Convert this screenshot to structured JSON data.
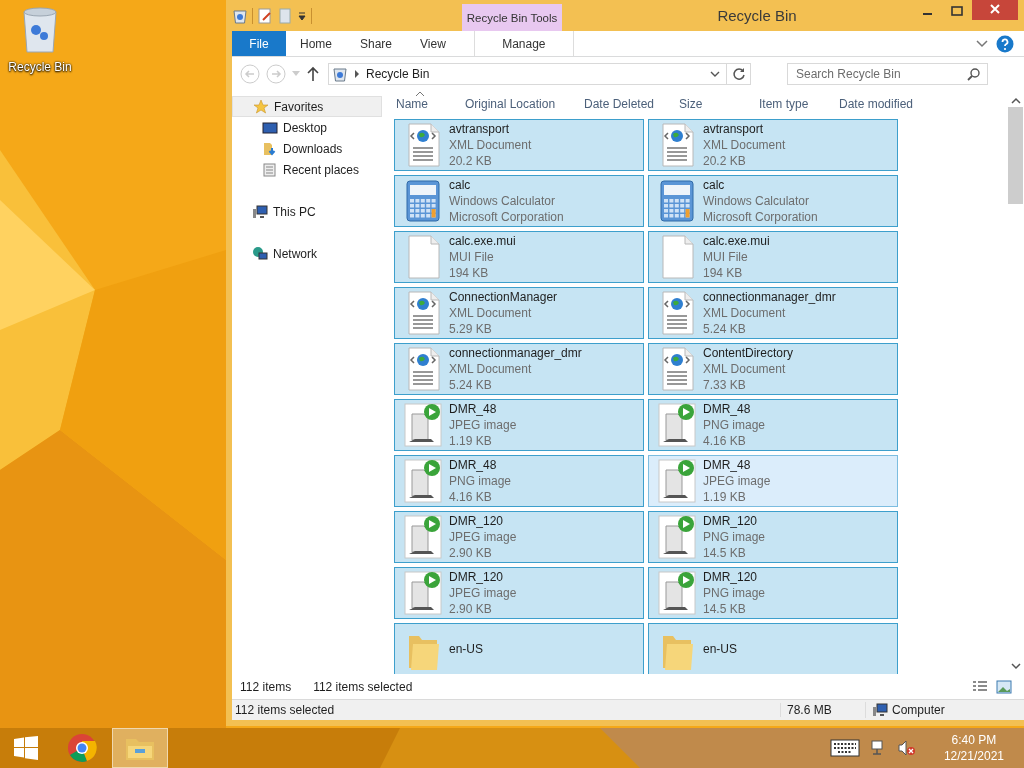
{
  "desktop": {
    "icons": [
      {
        "label": "Recycle Bin"
      }
    ]
  },
  "window": {
    "title": "Recycle Bin",
    "context_group": "Recycle Bin Tools"
  },
  "ribbon_tabs": [
    {
      "label": "File",
      "kind": "file",
      "selected": false
    },
    {
      "label": "Home",
      "kind": "plain",
      "selected": false
    },
    {
      "label": "Share",
      "kind": "plain",
      "selected": false
    },
    {
      "label": "View",
      "kind": "plain",
      "selected": false
    },
    {
      "label": "Manage",
      "kind": "context",
      "selected": false
    }
  ],
  "address_bar": {
    "path": "Recycle Bin"
  },
  "search": {
    "placeholder": "Search Recycle Bin"
  },
  "nav_pane": {
    "groups": [
      {
        "label": "Favorites",
        "kind": "star",
        "hovered": true,
        "children": [
          {
            "label": "Desktop",
            "kind": "desktop",
            "hovered": false
          },
          {
            "label": "Downloads",
            "kind": "downloads",
            "hovered": false
          },
          {
            "label": "Recent places",
            "kind": "recent",
            "hovered": false
          }
        ]
      },
      {
        "label": "This PC",
        "kind": "pc",
        "hovered": false
      },
      {
        "label": "Network",
        "kind": "network",
        "hovered": false
      }
    ]
  },
  "columns": [
    "Name",
    "Original Location",
    "Date Deleted",
    "Size",
    "Item type",
    "Date modified"
  ],
  "items": [
    {
      "name": "avtransport",
      "lines": [
        "XML Document",
        "20.2 KB"
      ],
      "kind": "xml",
      "selected": true,
      "hovered": false
    },
    {
      "name": "avtransport",
      "lines": [
        "XML Document",
        "20.2 KB"
      ],
      "kind": "xml",
      "selected": true,
      "hovered": false
    },
    {
      "name": "calc",
      "lines": [
        "Windows Calculator",
        "Microsoft Corporation"
      ],
      "kind": "calc",
      "selected": true,
      "hovered": false
    },
    {
      "name": "calc",
      "lines": [
        "Windows Calculator",
        "Microsoft Corporation"
      ],
      "kind": "calc",
      "selected": true,
      "hovered": false
    },
    {
      "name": "calc.exe.mui",
      "lines": [
        "MUI File",
        "194 KB"
      ],
      "kind": "blank",
      "selected": true,
      "hovered": false
    },
    {
      "name": "calc.exe.mui",
      "lines": [
        "MUI File",
        "194 KB"
      ],
      "kind": "blank",
      "selected": true,
      "hovered": false
    },
    {
      "name": "ConnectionManager",
      "lines": [
        "XML Document",
        "5.29 KB"
      ],
      "kind": "xml",
      "selected": true,
      "hovered": false
    },
    {
      "name": "connectionmanager_dmr",
      "lines": [
        "XML Document",
        "5.24 KB"
      ],
      "kind": "xml",
      "selected": true,
      "hovered": false
    },
    {
      "name": "connectionmanager_dmr",
      "lines": [
        "XML Document",
        "5.24 KB"
      ],
      "kind": "xml",
      "selected": true,
      "hovered": false
    },
    {
      "name": "ContentDirectory",
      "lines": [
        "XML Document",
        "7.33 KB"
      ],
      "kind": "xml",
      "selected": true,
      "hovered": false
    },
    {
      "name": "DMR_48",
      "lines": [
        "JPEG image",
        "1.19 KB"
      ],
      "kind": "media",
      "selected": true,
      "hovered": false
    },
    {
      "name": "DMR_48",
      "lines": [
        "PNG image",
        "4.16 KB"
      ],
      "kind": "media",
      "selected": true,
      "hovered": false
    },
    {
      "name": "DMR_48",
      "lines": [
        "PNG image",
        "4.16 KB"
      ],
      "kind": "media",
      "selected": true,
      "hovered": false
    },
    {
      "name": "DMR_48",
      "lines": [
        "JPEG image",
        "1.19 KB"
      ],
      "kind": "media",
      "selected": true,
      "hovered": true
    },
    {
      "name": "DMR_120",
      "lines": [
        "JPEG image",
        "2.90 KB"
      ],
      "kind": "media",
      "selected": true,
      "hovered": false
    },
    {
      "name": "DMR_120",
      "lines": [
        "PNG image",
        "14.5 KB"
      ],
      "kind": "media",
      "selected": true,
      "hovered": false
    },
    {
      "name": "DMR_120",
      "lines": [
        "JPEG image",
        "2.90 KB"
      ],
      "kind": "media",
      "selected": true,
      "hovered": false
    },
    {
      "name": "DMR_120",
      "lines": [
        "PNG image",
        "14.5 KB"
      ],
      "kind": "media",
      "selected": true,
      "hovered": false
    },
    {
      "name": "en-US",
      "kind": "folder",
      "selected": true,
      "hovered": false
    },
    {
      "name": "en-US",
      "kind": "folder",
      "selected": true,
      "hovered": false
    }
  ],
  "view_status": {
    "count": "112 items",
    "selected": "112 items selected"
  },
  "status_bar": {
    "selection": "112 items selected",
    "size": "78.6 MB",
    "location": "Computer"
  },
  "taskbar": {
    "apps": [
      {
        "kind": "start",
        "selected": false
      },
      {
        "kind": "chrome",
        "selected": false
      },
      {
        "kind": "explorer",
        "selected": true
      }
    ],
    "clock": {
      "time": "6:40 PM",
      "date": "12/21/2021"
    }
  }
}
